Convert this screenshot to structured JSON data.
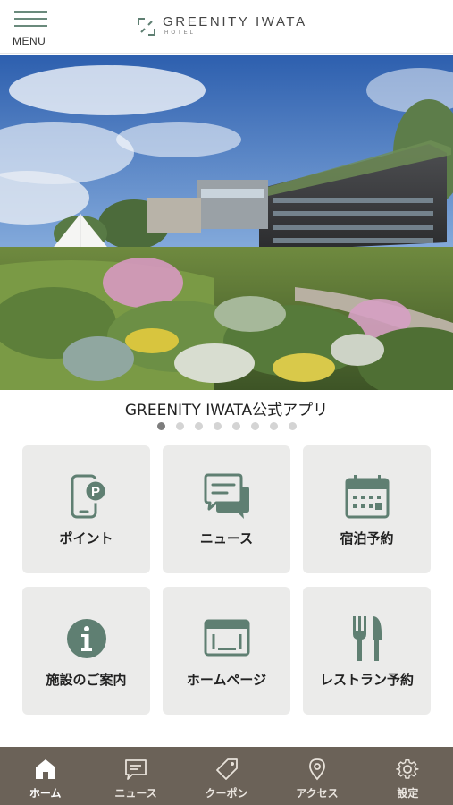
{
  "header": {
    "menu_label": "MENU",
    "logo_name": "GREENITY IWATA",
    "logo_sub": "HOTEL"
  },
  "hero": {
    "image": "hotel-garden-photo"
  },
  "app_title": "GREENITY IWATA公式アプリ",
  "carousel": {
    "total": 8,
    "active": 1
  },
  "tiles": [
    {
      "label": "ポイント",
      "icon": "phone-point-icon"
    },
    {
      "label": "ニュース",
      "icon": "chat-icon"
    },
    {
      "label": "宿泊予約",
      "icon": "calendar-icon"
    },
    {
      "label": "施設のご案内",
      "icon": "info-icon"
    },
    {
      "label": "ホームページ",
      "icon": "browser-icon"
    },
    {
      "label": "レストラン予約",
      "icon": "cutlery-icon"
    }
  ],
  "tabbar": [
    {
      "label": "ホーム",
      "icon": "home-icon"
    },
    {
      "label": "ニュース",
      "icon": "news-icon"
    },
    {
      "label": "クーポン",
      "icon": "coupon-icon"
    },
    {
      "label": "アクセス",
      "icon": "location-icon"
    },
    {
      "label": "設定",
      "icon": "gear-icon"
    }
  ],
  "colors": {
    "accent": "#5f7f72",
    "tile_bg": "#ebebea",
    "tabbar_bg": "#6b6258"
  }
}
